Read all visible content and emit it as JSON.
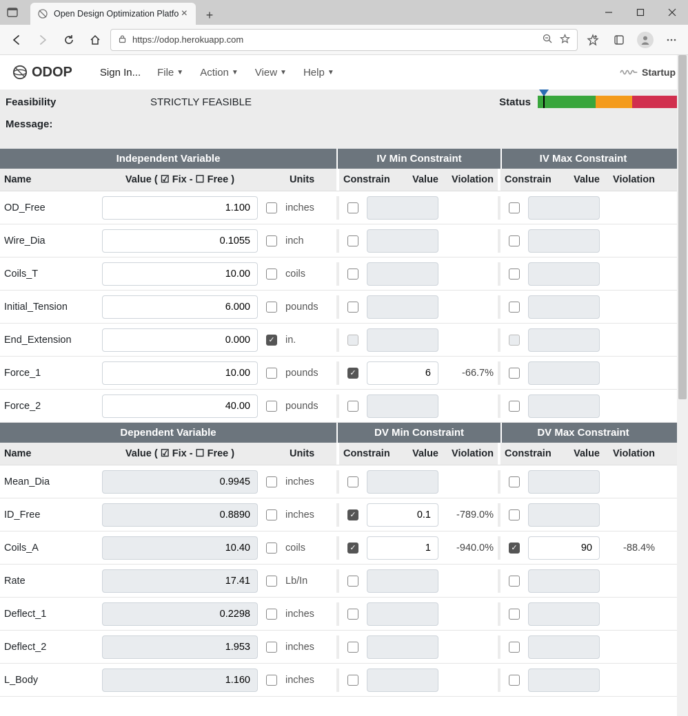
{
  "browser": {
    "tab_title": "Open Design Optimization Platfo",
    "url": "https://odop.herokuapp.com"
  },
  "app": {
    "brand": "ODOP",
    "menu": {
      "signin": "Sign In...",
      "file": "File",
      "action": "Action",
      "view": "View",
      "help": "Help"
    },
    "startup_label": "Startup"
  },
  "feasibility": {
    "label": "Feasibility",
    "value": "STRICTLY FEASIBLE"
  },
  "message": {
    "label": "Message:",
    "value": ""
  },
  "status": {
    "label": "Status"
  },
  "sections": {
    "iv": {
      "main": "Independent Variable",
      "min": "IV Min Constraint",
      "max": "IV Max Constraint"
    },
    "dv": {
      "main": "Dependent Variable",
      "min": "DV Min Constraint",
      "max": "DV Max Constraint"
    }
  },
  "columns": {
    "name": "Name",
    "value_hdr": "Value ( ☑ Fix - ☐ Free )",
    "units": "Units",
    "constrain": "Constrain",
    "value": "Value",
    "violation": "Violation"
  },
  "iv_rows": [
    {
      "name": "OD_Free",
      "value": "1.100",
      "fix": false,
      "units": "inches",
      "min_c": false,
      "min_v": "",
      "min_viol": "",
      "max_c": false,
      "max_v": "",
      "max_viol": "",
      "readonly": false
    },
    {
      "name": "Wire_Dia",
      "value": "0.1055",
      "fix": false,
      "units": "inch",
      "min_c": false,
      "min_v": "",
      "min_viol": "",
      "max_c": false,
      "max_v": "",
      "max_viol": "",
      "readonly": false
    },
    {
      "name": "Coils_T",
      "value": "10.00",
      "fix": false,
      "units": "coils",
      "min_c": false,
      "min_v": "",
      "min_viol": "",
      "max_c": false,
      "max_v": "",
      "max_viol": "",
      "readonly": false
    },
    {
      "name": "Initial_Tension",
      "value": "6.000",
      "fix": false,
      "units": "pounds",
      "min_c": false,
      "min_v": "",
      "min_viol": "",
      "max_c": false,
      "max_v": "",
      "max_viol": "",
      "readonly": false
    },
    {
      "name": "End_Extension",
      "value": "0.000",
      "fix": true,
      "units": "in.",
      "min_c": false,
      "min_v": "",
      "min_viol": "",
      "max_c": false,
      "max_v": "",
      "max_viol": "",
      "readonly": false,
      "constraint_disabled": true
    },
    {
      "name": "Force_1",
      "value": "10.00",
      "fix": false,
      "units": "pounds",
      "min_c": true,
      "min_v": "6",
      "min_viol": "-66.7%",
      "max_c": false,
      "max_v": "",
      "max_viol": "",
      "readonly": false
    },
    {
      "name": "Force_2",
      "value": "40.00",
      "fix": false,
      "units": "pounds",
      "min_c": false,
      "min_v": "",
      "min_viol": "",
      "max_c": false,
      "max_v": "",
      "max_viol": "",
      "readonly": false
    }
  ],
  "dv_rows": [
    {
      "name": "Mean_Dia",
      "value": "0.9945",
      "fix": false,
      "units": "inches",
      "min_c": false,
      "min_v": "",
      "min_viol": "",
      "max_c": false,
      "max_v": "",
      "max_viol": "",
      "readonly": true
    },
    {
      "name": "ID_Free",
      "value": "0.8890",
      "fix": false,
      "units": "inches",
      "min_c": true,
      "min_v": "0.1",
      "min_viol": "-789.0%",
      "max_c": false,
      "max_v": "",
      "max_viol": "",
      "readonly": true
    },
    {
      "name": "Coils_A",
      "value": "10.40",
      "fix": false,
      "units": "coils",
      "min_c": true,
      "min_v": "1",
      "min_viol": "-940.0%",
      "max_c": true,
      "max_v": "90",
      "max_viol": "-88.4%",
      "readonly": true
    },
    {
      "name": "Rate",
      "value": "17.41",
      "fix": false,
      "units": "Lb/In",
      "min_c": false,
      "min_v": "",
      "min_viol": "",
      "max_c": false,
      "max_v": "",
      "max_viol": "",
      "readonly": true
    },
    {
      "name": "Deflect_1",
      "value": "0.2298",
      "fix": false,
      "units": "inches",
      "min_c": false,
      "min_v": "",
      "min_viol": "",
      "max_c": false,
      "max_v": "",
      "max_viol": "",
      "readonly": true
    },
    {
      "name": "Deflect_2",
      "value": "1.953",
      "fix": false,
      "units": "inches",
      "min_c": false,
      "min_v": "",
      "min_viol": "",
      "max_c": false,
      "max_v": "",
      "max_viol": "",
      "readonly": true
    },
    {
      "name": "L_Body",
      "value": "1.160",
      "fix": false,
      "units": "inches",
      "min_c": false,
      "min_v": "",
      "min_viol": "",
      "max_c": false,
      "max_v": "",
      "max_viol": "",
      "readonly": true
    }
  ]
}
